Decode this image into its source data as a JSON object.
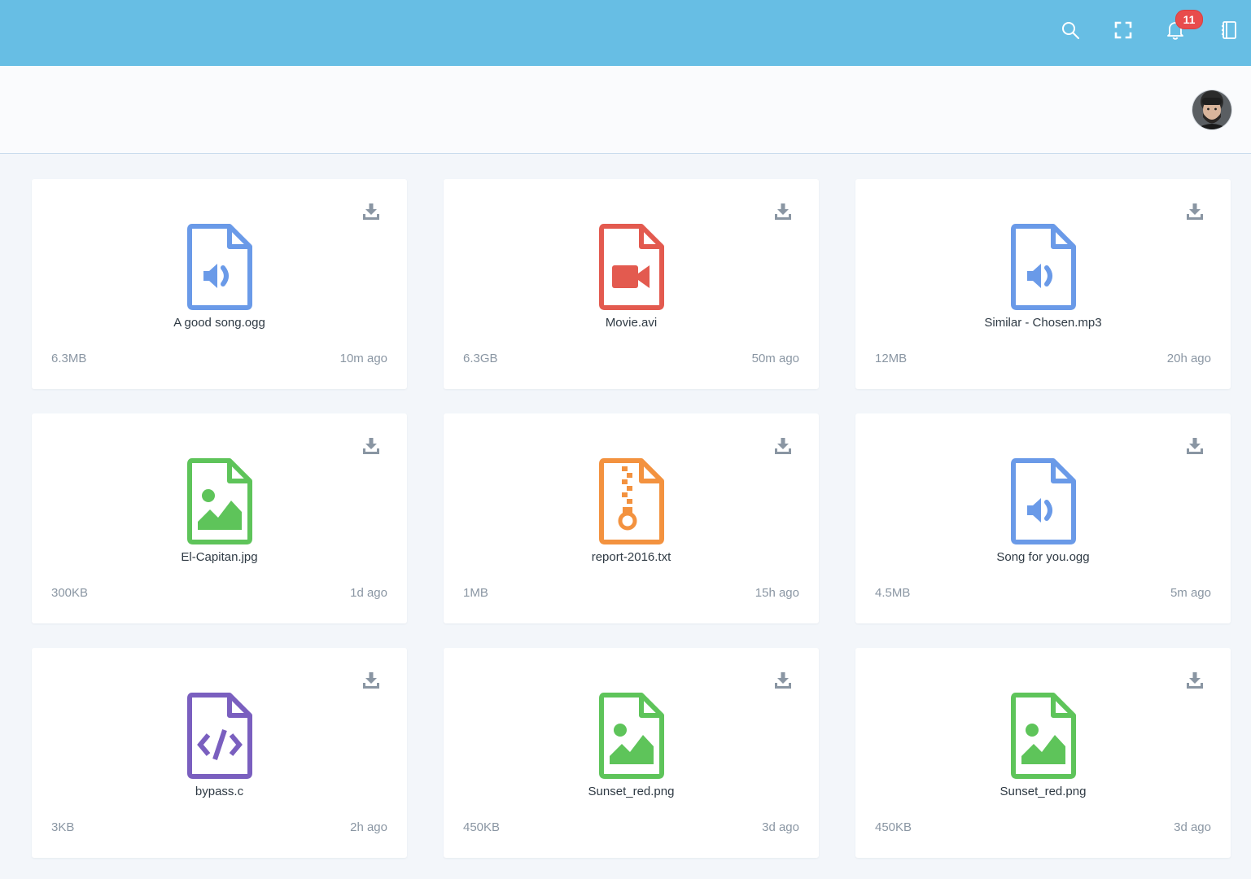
{
  "header": {
    "notifications_count": "11",
    "icons": [
      "search-icon",
      "fullscreen-icon",
      "bell-icon",
      "notebook-icon"
    ],
    "accent_color": "#67bee4"
  },
  "files": [
    {
      "name": "A good song.ogg",
      "size": "6.3MB",
      "time": "10m ago",
      "type": "audio",
      "color": "#6a9ae8"
    },
    {
      "name": "Movie.avi",
      "size": "6.3GB",
      "time": "50m ago",
      "type": "video",
      "color": "#e35a4f"
    },
    {
      "name": "Similar - Chosen.mp3",
      "size": "12MB",
      "time": "20h ago",
      "type": "audio",
      "color": "#6a9ae8"
    },
    {
      "name": "El-Capitan.jpg",
      "size": "300KB",
      "time": "1d ago",
      "type": "image",
      "color": "#5ec45a"
    },
    {
      "name": "report-2016.txt",
      "size": "1MB",
      "time": "15h ago",
      "type": "archive",
      "color": "#f3923f"
    },
    {
      "name": "Song for you.ogg",
      "size": "4.5MB",
      "time": "5m ago",
      "type": "audio",
      "color": "#6a9ae8"
    },
    {
      "name": "bypass.c",
      "size": "3KB",
      "time": "2h ago",
      "type": "code",
      "color": "#7a5fbf"
    },
    {
      "name": "Sunset_red.png",
      "size": "450KB",
      "time": "3d ago",
      "type": "image",
      "color": "#5ec45a"
    },
    {
      "name": "Sunset_red.png",
      "size": "450KB",
      "time": "3d ago",
      "type": "image",
      "color": "#5ec45a"
    }
  ]
}
